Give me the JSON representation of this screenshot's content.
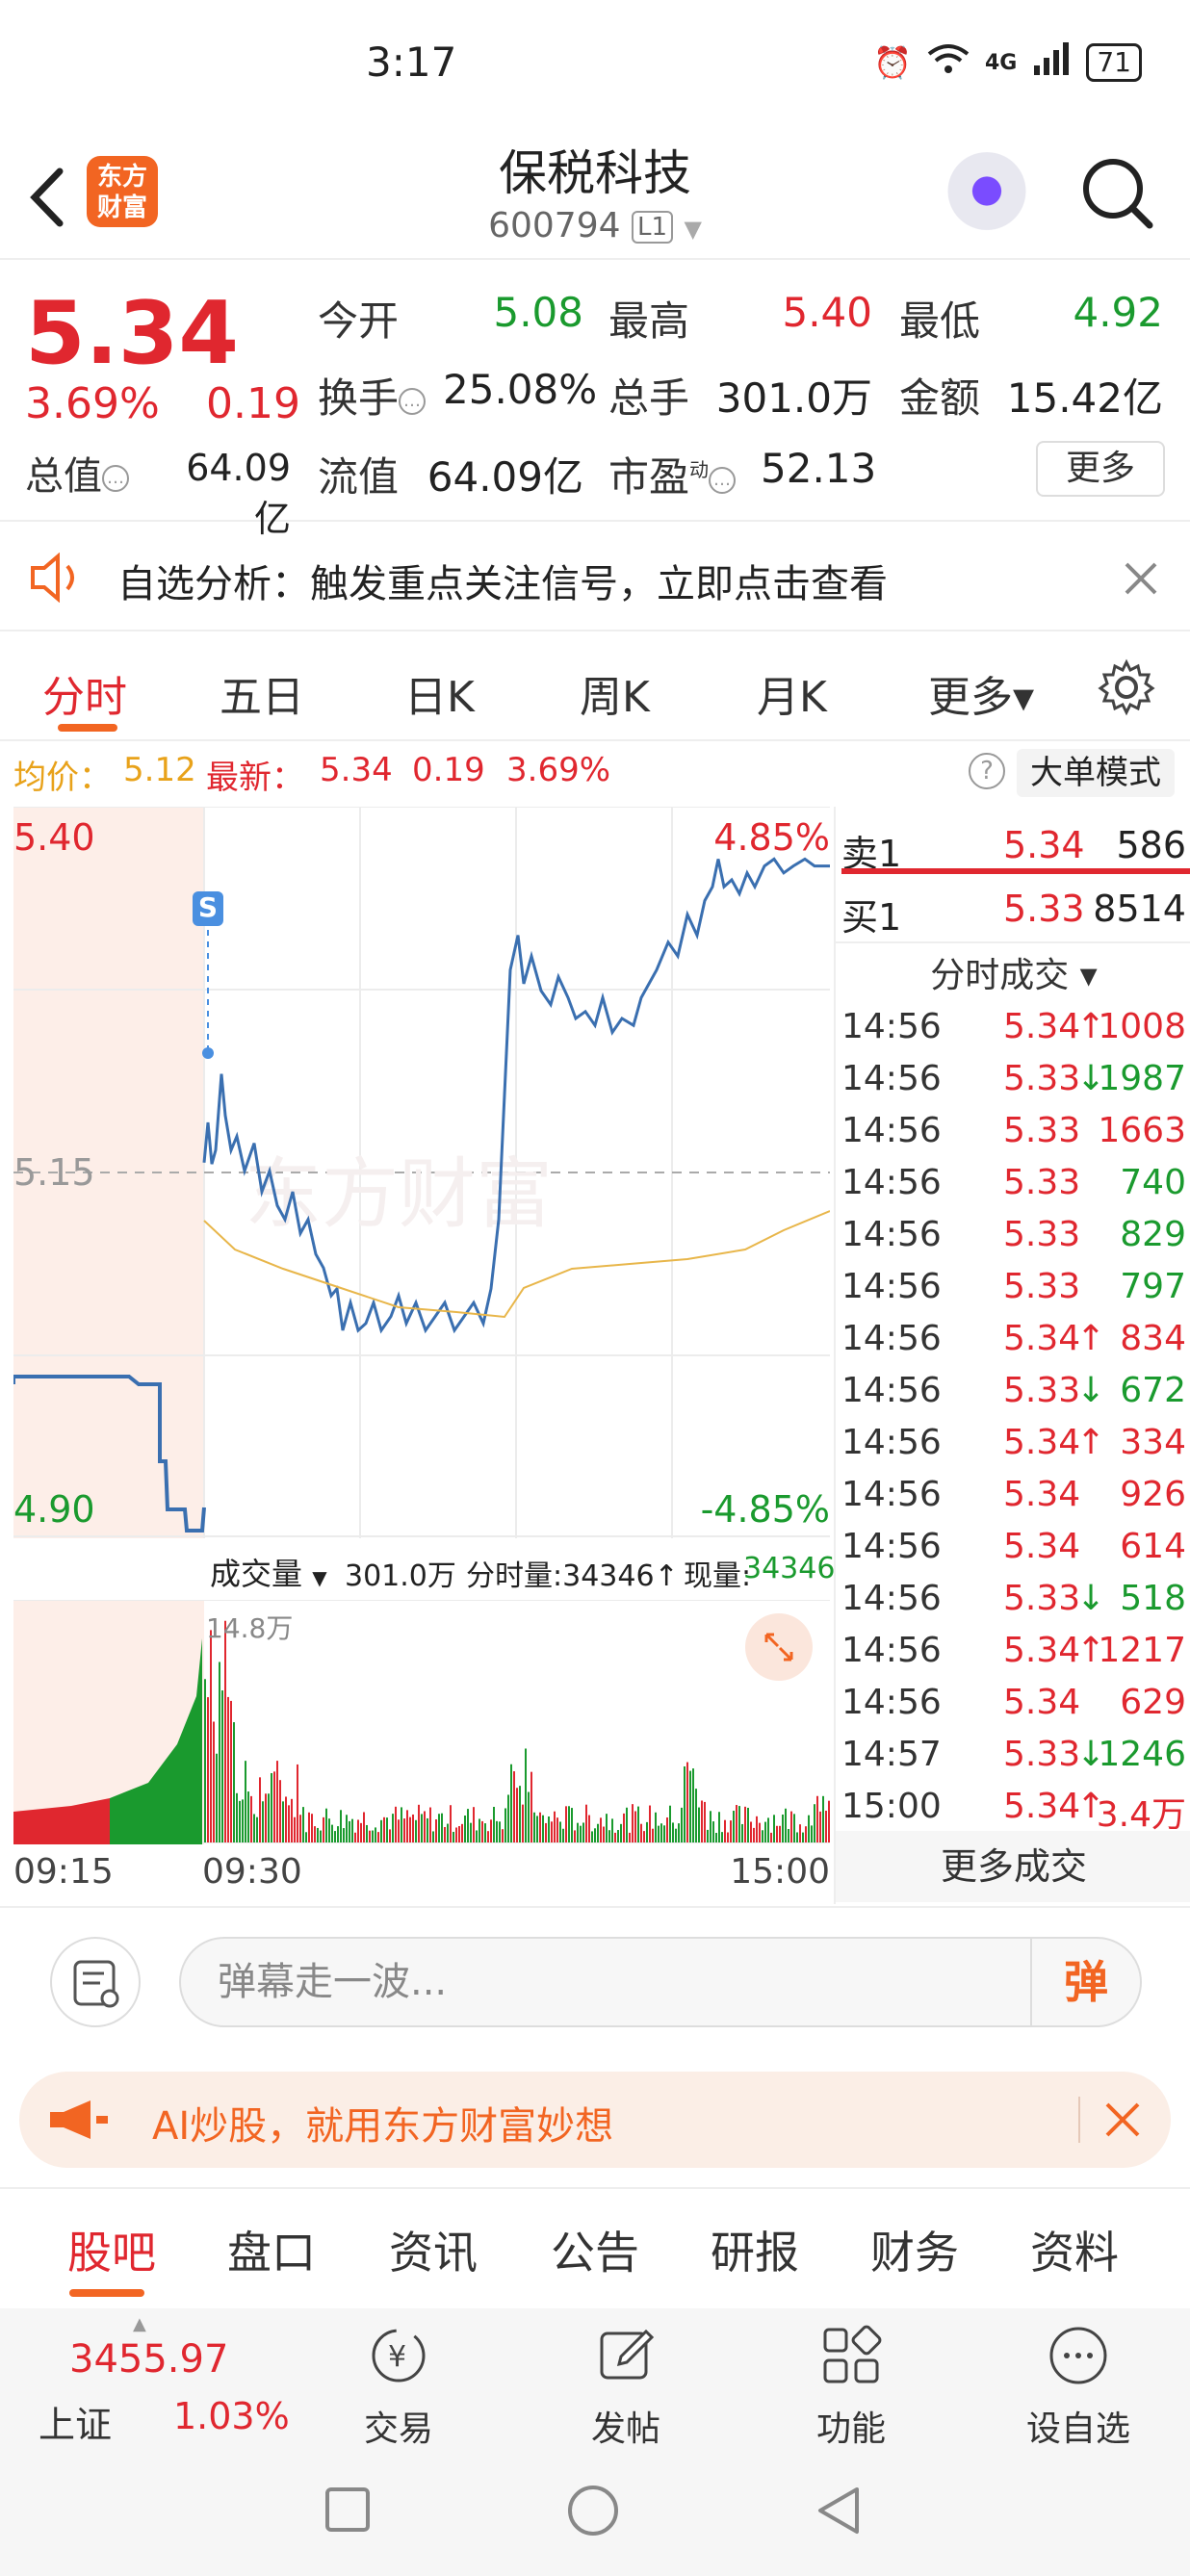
{
  "status_bar": {
    "time": "3:17",
    "battery": "71",
    "network": "4G"
  },
  "header": {
    "logo_line1": "东方",
    "logo_line2": "财富",
    "stock_name": "保税科技",
    "stock_code": "600794",
    "level_badge": "L1"
  },
  "quote": {
    "last_price": "5.34",
    "change_pct": "3.69%",
    "change_val": "0.19",
    "open_label": "今开",
    "open": "5.08",
    "high_label": "最高",
    "high": "5.40",
    "low_label": "最低",
    "low": "4.92",
    "turnover_label": "换手",
    "turnover": "25.08%",
    "volume_label": "总手",
    "volume": "301.0万",
    "amount_label": "金额",
    "amount": "15.42亿",
    "mktcap_label": "总值",
    "mktcap": "64.09亿",
    "float_label": "流值",
    "float_cap": "64.09亿",
    "pe_label": "市盈",
    "pe_super": "动",
    "pe": "52.13",
    "more_btn": "更多"
  },
  "alert": {
    "text": "自选分析：触发重点关注信号，立即点击查看"
  },
  "chart_tabs": [
    "分时",
    "五日",
    "日K",
    "周K",
    "月K",
    "更多▾"
  ],
  "avg_row": {
    "avg_label": "均价：",
    "avg": "5.12",
    "latest_label": "最新：",
    "latest": "5.34",
    "chg": "0.19",
    "pct": "3.69%",
    "mode_btn": "大单模式"
  },
  "chart_labels": {
    "top_left": "5.40",
    "mid_left": "5.15",
    "bottom_left": "4.90",
    "top_right": "4.85%",
    "bottom_right": "-4.85%",
    "marker": "S"
  },
  "volume_header": {
    "selector": "成交量",
    "total": "301.0万",
    "tick_label": "分时量:34346↑",
    "now_label": "现量:",
    "now_val": "34346",
    "max_label": "14.8万"
  },
  "time_axis": [
    "09:15",
    "09:30",
    "15:00"
  ],
  "order_book": {
    "ask_label": "卖1",
    "ask_price": "5.34",
    "ask_vol": "586",
    "bid_label": "买1",
    "bid_price": "5.33",
    "bid_vol": "8514",
    "trades_title": "分时成交 ▾",
    "trades": [
      {
        "t": "14:56",
        "p": "5.34",
        "d": "↑",
        "v": "1008",
        "dir": "up"
      },
      {
        "t": "14:56",
        "p": "5.33",
        "d": "↓",
        "v": "1987",
        "dir": "down"
      },
      {
        "t": "14:56",
        "p": "5.33",
        "d": "",
        "v": "1663",
        "dir": "neutral"
      },
      {
        "t": "14:56",
        "p": "5.33",
        "d": "",
        "v": "740",
        "dir": "neutral-g"
      },
      {
        "t": "14:56",
        "p": "5.33",
        "d": "",
        "v": "829",
        "dir": "neutral-g"
      },
      {
        "t": "14:56",
        "p": "5.33",
        "d": "",
        "v": "797",
        "dir": "neutral-g"
      },
      {
        "t": "14:56",
        "p": "5.34",
        "d": "↑",
        "v": "834",
        "dir": "up"
      },
      {
        "t": "14:56",
        "p": "5.33",
        "d": "↓",
        "v": "672",
        "dir": "down"
      },
      {
        "t": "14:56",
        "p": "5.34",
        "d": "↑",
        "v": "334",
        "dir": "up"
      },
      {
        "t": "14:56",
        "p": "5.34",
        "d": "",
        "v": "926",
        "dir": "neutral"
      },
      {
        "t": "14:56",
        "p": "5.34",
        "d": "",
        "v": "614",
        "dir": "neutral"
      },
      {
        "t": "14:56",
        "p": "5.33",
        "d": "↓",
        "v": "518",
        "dir": "down"
      },
      {
        "t": "14:56",
        "p": "5.34",
        "d": "↑",
        "v": "1217",
        "dir": "up"
      },
      {
        "t": "14:56",
        "p": "5.34",
        "d": "",
        "v": "629",
        "dir": "neutral"
      },
      {
        "t": "14:57",
        "p": "5.33",
        "d": "↓",
        "v": "1246",
        "dir": "down"
      },
      {
        "t": "15:00",
        "p": "5.34",
        "d": "↑",
        "v": "3.4万",
        "dir": "up"
      }
    ],
    "more_trades": "更多成交"
  },
  "comment": {
    "placeholder": "弹幕走一波...",
    "danmu_btn": "弹"
  },
  "ai_banner": {
    "text": "AI炒股，就用东方财富妙想"
  },
  "bottom_tabs": [
    "股吧",
    "盘口",
    "资讯",
    "公告",
    "研报",
    "财务",
    "资料"
  ],
  "bottom_nav": {
    "index_value": "3455.97",
    "index_name": "上证",
    "index_chg": "1.03%",
    "items": [
      "交易",
      "发帖",
      "功能",
      "设自选"
    ]
  },
  "colors": {
    "up": "#e0272f",
    "down": "#1a9a2e",
    "accent": "#f26522",
    "avg_line": "#e8b64a",
    "price_line": "#3a6fb0"
  }
}
